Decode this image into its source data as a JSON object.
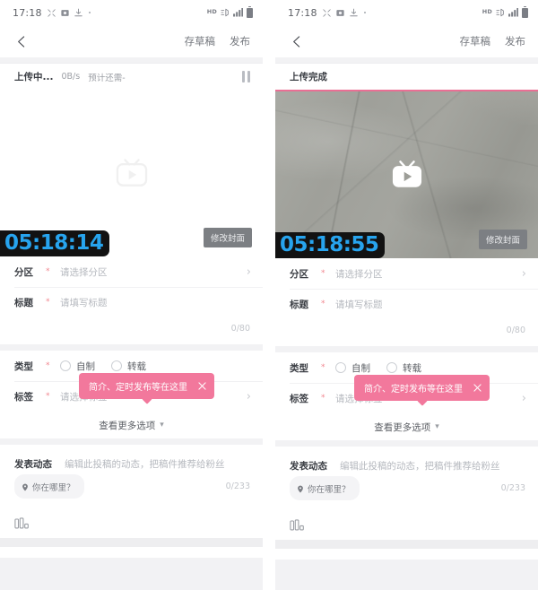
{
  "panels": [
    {
      "id": "left",
      "status_bar": {
        "time": "17:18",
        "left_icons": [
          "shrink-icon",
          "camera-icon",
          "download-icon",
          "more-dot-icon"
        ],
        "right_icons": [
          "hd-icon",
          "network-icon",
          "signal-icon",
          "battery-icon"
        ],
        "hd_label": "HD"
      },
      "nav": {
        "back_icon": "back-arrow-icon",
        "save_draft": "存草稿",
        "publish": "发布"
      },
      "upload": {
        "title": "上传中...",
        "speed": "0B/s",
        "eta": "预计还需-",
        "pause_icon": "pause-icon",
        "show_pause": true,
        "show_progress_bar": false,
        "progress_percent": 0
      },
      "video": {
        "filled": false,
        "play_icon": "bilibili-play-icon",
        "timestamp": "05:18:14",
        "cover_button": "修改封面"
      },
      "form": {
        "category": {
          "label": "分区",
          "required": "*",
          "placeholder": "请选择分区",
          "chevron": "chevron-right-icon"
        },
        "title": {
          "label": "标题",
          "required": "*",
          "placeholder": "请填写标题",
          "counter": "0/80"
        },
        "type": {
          "label": "类型",
          "required": "*",
          "options": [
            {
              "label": "自制",
              "selected": false
            },
            {
              "label": "转载",
              "selected": false
            }
          ]
        },
        "tags": {
          "label": "标签",
          "required": "*",
          "placeholder": "请选择标签",
          "chevron": "chevron-right-icon"
        },
        "more_options": {
          "label": "查看更多选项",
          "chevron": "chevron-down-icon"
        }
      },
      "tooltip": {
        "text": "简介、定时发布等在这里",
        "close_icon": "close-icon",
        "color": "#F2789C"
      },
      "dynamic": {
        "label": "发表动态",
        "placeholder": "编辑此投稿的动态，把稿件推荐给粉丝",
        "location_chip": "你在哪里？",
        "location_icon": "location-pin-icon",
        "counter": "0/233"
      },
      "bottom": {
        "topic_icon": "bar-chart-topic-icon"
      }
    },
    {
      "id": "right",
      "status_bar": {
        "time": "17:18",
        "left_icons": [
          "shrink-icon",
          "camera-icon",
          "download-icon",
          "more-dot-icon"
        ],
        "right_icons": [
          "hd-icon",
          "network-icon",
          "signal-icon",
          "battery-icon"
        ],
        "hd_label": "HD"
      },
      "nav": {
        "back_icon": "back-arrow-icon",
        "save_draft": "存草稿",
        "publish": "发布"
      },
      "upload": {
        "title": "上传完成",
        "speed": "",
        "eta": "",
        "pause_icon": "pause-icon",
        "show_pause": false,
        "show_progress_bar": true,
        "progress_percent": 100
      },
      "video": {
        "filled": true,
        "play_icon": "bilibili-play-icon",
        "timestamp": "05:18:55",
        "cover_button": "修改封面"
      },
      "form": {
        "category": {
          "label": "分区",
          "required": "*",
          "placeholder": "请选择分区",
          "chevron": "chevron-right-icon"
        },
        "title": {
          "label": "标题",
          "required": "*",
          "placeholder": "请填写标题",
          "counter": "0/80"
        },
        "type": {
          "label": "类型",
          "required": "*",
          "options": [
            {
              "label": "自制",
              "selected": false
            },
            {
              "label": "转载",
              "selected": false
            }
          ]
        },
        "tags": {
          "label": "标签",
          "required": "*",
          "placeholder": "请选择标签",
          "chevron": "chevron-right-icon"
        },
        "more_options": {
          "label": "查看更多选项",
          "chevron": "chevron-down-icon"
        }
      },
      "tooltip": {
        "text": "简介、定时发布等在这里",
        "close_icon": "close-icon",
        "color": "#F2789C"
      },
      "dynamic": {
        "label": "发表动态",
        "placeholder": "编辑此投稿的动态，把稿件推荐给粉丝",
        "location_chip": "你在哪里？",
        "location_icon": "location-pin-icon",
        "counter": "0/233"
      },
      "bottom": {
        "topic_icon": "bar-chart-topic-icon"
      }
    }
  ],
  "theme": {
    "accent_pink": "#F2789C",
    "progress_pink": "#E96F94",
    "timestamp_blue": "#27A4EE",
    "required_star": "#F1868F",
    "page_bg": "#F2F2F4",
    "card_bg": "#FFFFFF"
  }
}
